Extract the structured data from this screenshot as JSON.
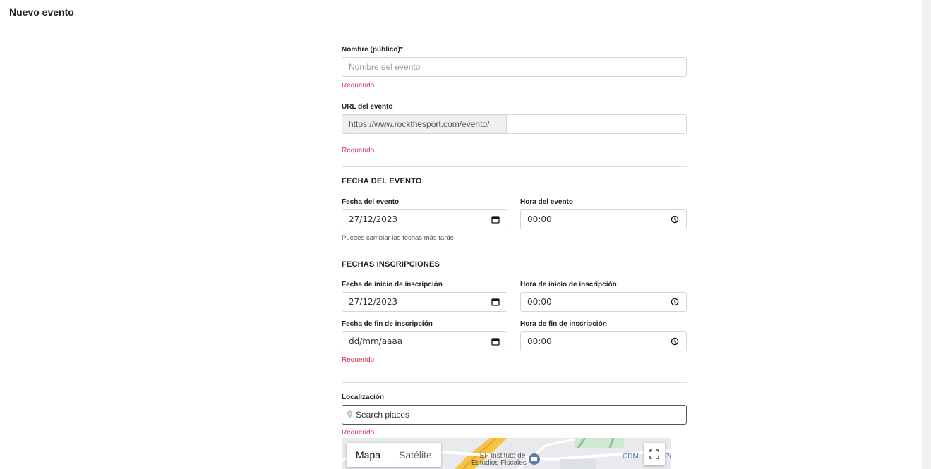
{
  "header": {
    "title": "Nuevo evento"
  },
  "form": {
    "name": {
      "label": "Nombre (público)*",
      "placeholder": "Nombre del evento",
      "error": "Requerido"
    },
    "url": {
      "label": "URL del evento",
      "prefix": "https://www.rockthesport.com/evento/",
      "value": "",
      "error": "Requerido"
    },
    "event_date_section": {
      "title": "FECHA DEL EVENTO",
      "date_label": "Fecha del evento",
      "date_value": "27/12/2023",
      "time_label": "Hora del evento",
      "time_value": "00:00",
      "hint": "Puedes cambiar las fechas más tarde"
    },
    "registration_section": {
      "title": "FECHAS INSCRIPCIONES",
      "start_date_label": "Fecha de inicio de inscripción",
      "start_date_value": "27/12/2023",
      "start_time_label": "Hora de inicio de inscripción",
      "start_time_value": "00:00",
      "end_date_label": "Fecha de fin de inscripción",
      "end_date_value": "dd/mm/aaaa",
      "end_time_label": "Hora de fin de inscripción",
      "end_time_value": "00:00",
      "error": "Requerido"
    },
    "location": {
      "label": "Localización",
      "placeholder": "Search places",
      "error": "Requerido"
    }
  },
  "map": {
    "type_buttons": [
      "Mapa",
      "Satélite"
    ],
    "labels": [
      "IEF Instituto de",
      "Estudios Fiscales",
      "CDM",
      "Pe"
    ]
  },
  "icons": {
    "calendar": "calendar-icon",
    "clock": "clock-icon",
    "pin": "map-pin-icon",
    "fullscreen": "fullscreen-icon"
  }
}
